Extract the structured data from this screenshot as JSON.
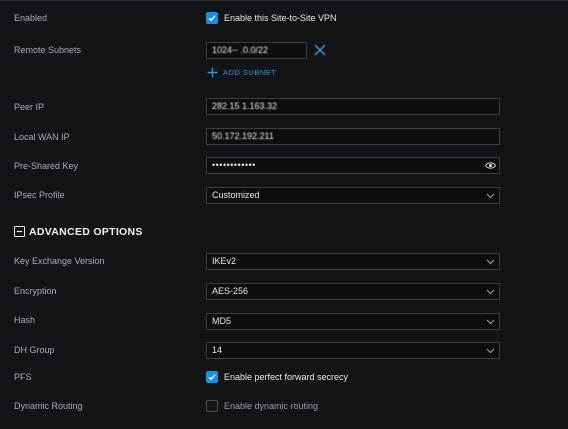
{
  "enabled": {
    "label": "Enabled",
    "checkbox_label": "Enable this Site-to-Site VPN",
    "checked": true
  },
  "remote_subnets": {
    "label": "Remote Subnets",
    "value": "1024-- .0.0/22",
    "add_label": "ADD SUBNET"
  },
  "peer_ip": {
    "label": "Peer IP",
    "value": "282.15 1.163.32"
  },
  "local_wan_ip": {
    "label": "Local WAN IP",
    "value": "50.172.192.211"
  },
  "pre_shared_key": {
    "label": "Pre-Shared Key",
    "value": "••••••••••••"
  },
  "ipsec_profile": {
    "label": "IPsec Profile",
    "value": "Customized"
  },
  "advanced": {
    "title": "ADVANCED OPTIONS",
    "key_exchange": {
      "label": "Key Exchange Version",
      "value": "IKEv2"
    },
    "encryption": {
      "label": "Encryption",
      "value": "AES-256"
    },
    "hash": {
      "label": "Hash",
      "value": "MD5"
    },
    "dh_group": {
      "label": "DH Group",
      "value": "14"
    },
    "pfs": {
      "label": "PFS",
      "checkbox_label": "Enable perfect forward secrecy",
      "checked": true
    },
    "dynamic_routing": {
      "label": "Dynamic Routing",
      "checkbox_label": "Enable dynamic routing",
      "checked": false
    }
  },
  "colors": {
    "background": "#121417",
    "accent": "#1a8fe0",
    "field_border": "#3b3f44"
  }
}
